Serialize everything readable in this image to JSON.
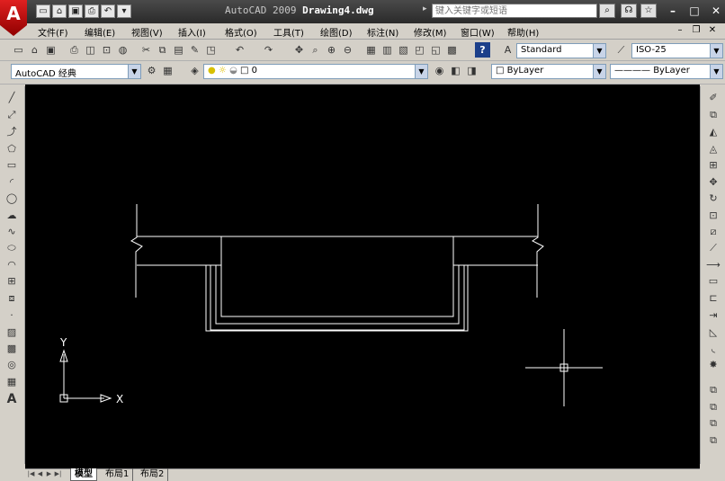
{
  "app": {
    "logo_letter": "A",
    "title_prefix": "AutoCAD 2009",
    "document_name": "Drawing4.dwg",
    "search_placeholder": "键入关键字或短语"
  },
  "menu": {
    "items": [
      "文件(F)",
      "编辑(E)",
      "视图(V)",
      "插入(I)",
      "格式(O)",
      "工具(T)",
      "绘图(D)",
      "标注(N)",
      "修改(M)",
      "窗口(W)",
      "帮助(H)"
    ]
  },
  "toolbars": {
    "text_style": "Standard",
    "dim_style": "ISO-25",
    "workspace": "AutoCAD 经典",
    "layer_name": "0",
    "color": "ByLayer",
    "linetype": "ByLayer"
  },
  "ucs": {
    "x_label": "X",
    "y_label": "Y"
  },
  "tabs": [
    "模型",
    "布局1",
    "布局2"
  ],
  "colors": {
    "canvas": "#000000",
    "line": "#ffffff",
    "title_bg": "#2a2a2a",
    "accent_red": "#cc1111"
  }
}
